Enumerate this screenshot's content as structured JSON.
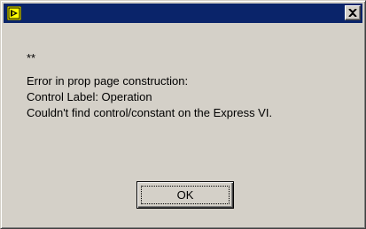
{
  "window": {
    "icon": "labview-express-icon",
    "close_icon": "close-icon",
    "title": ""
  },
  "message": {
    "line1": "**",
    "line2": "Error in prop page construction:",
    "line3": "Control Label: Operation",
    "line4": "Couldn't find control/constant on the Express VI."
  },
  "buttons": {
    "ok_label": "OK"
  },
  "colors": {
    "titlebar": "#0a246a",
    "face": "#d4d0c8",
    "icon_yellow": "#ffff00"
  }
}
